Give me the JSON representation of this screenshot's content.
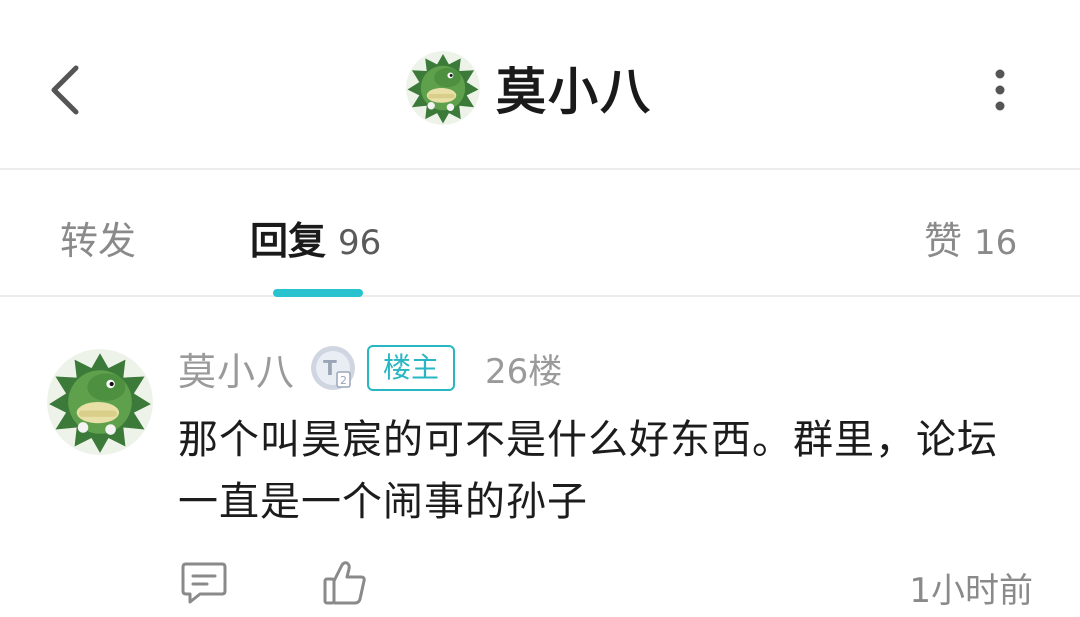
{
  "header": {
    "title": "莫小八",
    "back_icon": "chevron-left-icon",
    "more_icon": "more-vertical-icon",
    "avatar": "green-dragon-avatar"
  },
  "tabs": [
    {
      "label": "转发",
      "count": ""
    },
    {
      "label": "回复",
      "count": "96",
      "active": true
    },
    {
      "label": "赞",
      "count": "16"
    }
  ],
  "colors": {
    "accent": "#29c3cf",
    "badge": "#29b6c3"
  },
  "post": {
    "author": "莫小八",
    "level_badge": "T2",
    "owner_badge": "楼主",
    "floor": "26楼",
    "content": "那个叫昊宸的可不是什么好东西。群里，论坛一直是一个闹事的孙子",
    "time": "1小时前",
    "comment_icon": "comment-icon",
    "like_icon": "thumbs-up-icon"
  }
}
